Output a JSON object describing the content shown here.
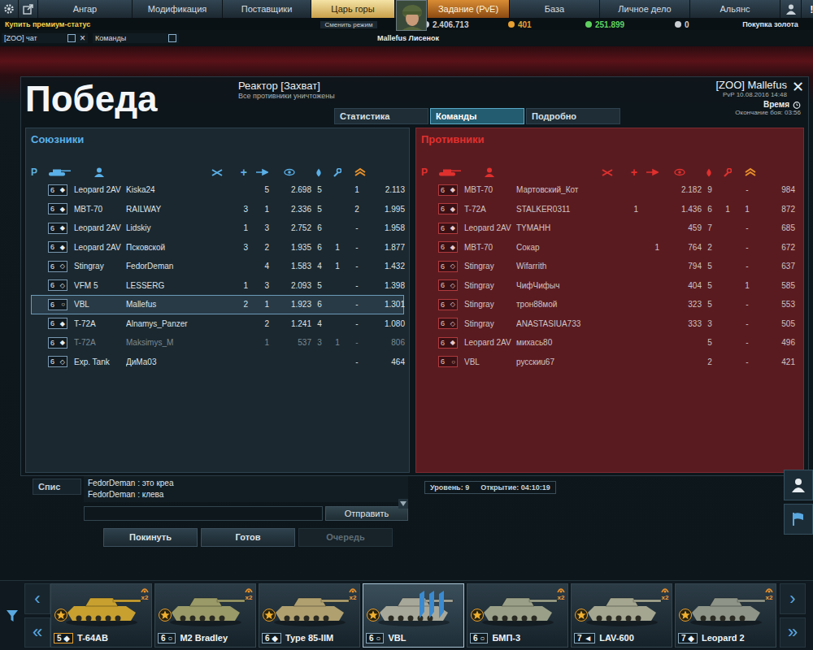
{
  "top_nav": {
    "left_tabs": [
      {
        "label": "Ангар",
        "selected": false,
        "kind": "normal"
      },
      {
        "label": "Модификация",
        "selected": false,
        "kind": "normal"
      },
      {
        "label": "Поставщики",
        "selected": false,
        "kind": "normal"
      },
      {
        "label": "Царь горы",
        "selected": true,
        "kind": "normal"
      }
    ],
    "right_tabs": [
      {
        "label": "Задание (PvE)",
        "selected": false,
        "kind": "mission"
      },
      {
        "label": "База",
        "selected": false,
        "kind": "normal"
      },
      {
        "label": "Личное дело",
        "selected": false,
        "kind": "normal"
      },
      {
        "label": "Альянс",
        "selected": false,
        "kind": "normal"
      }
    ],
    "alert": "!"
  },
  "sub_bar": {
    "premium": "Купить премиум-статус",
    "mode_switch": "Сменить режим",
    "currencies": [
      {
        "value": "2.406.713",
        "color": "#c9ced2"
      },
      {
        "value": "401",
        "color": "#e8a030"
      },
      {
        "value": "251.899",
        "color": "#5fd060"
      },
      {
        "value": "0",
        "color": "#c9ced2"
      }
    ],
    "buy_gold": "Покупка золота"
  },
  "chat_bar": {
    "filters": [
      {
        "label": "[ZOO] чат",
        "checked": false,
        "close": "×"
      },
      {
        "label": "Команды",
        "checked": false,
        "close": ""
      }
    ]
  },
  "player_name": "Mallefus Лисенок",
  "result": {
    "title": "Победа",
    "map": "Реактор [Захват]",
    "outcome": "Все противники уничтожены",
    "tabs": [
      {
        "label": "Статистика",
        "selected": false
      },
      {
        "label": "Команды",
        "selected": true
      },
      {
        "label": "Подробно",
        "selected": false
      }
    ],
    "player": "[ZOO] Mallefus",
    "match_info": "PvP 10.08.2016 14:48",
    "time_label": "Время",
    "battle_end": "Окончание боя: 03:56",
    "close": "✕"
  },
  "teams": [
    {
      "kind": "allies",
      "title": "Союзники",
      "rank_header": "Р",
      "assist_header": "+",
      "rows": [
        {
          "tier": "6",
          "class_icon": "◆",
          "vehicle": "Leopard 2AV",
          "player": "Kiska24",
          "kills": "",
          "assists": "5",
          "damage": "2.698",
          "spotted": "5",
          "blocked": "",
          "repairs": "1",
          "score": "2.113",
          "selected": false,
          "dimmed": false
        },
        {
          "tier": "6",
          "class_icon": "◆",
          "vehicle": "MBT-70",
          "player": "RAILWAY",
          "kills": "3",
          "assists": "1",
          "damage": "2.336",
          "spotted": "5",
          "blocked": "",
          "repairs": "2",
          "score": "1.995",
          "selected": false,
          "dimmed": false
        },
        {
          "tier": "6",
          "class_icon": "◆",
          "vehicle": "Leopard 2AV",
          "player": "Lidskiy",
          "kills": "1",
          "assists": "3",
          "damage": "2.752",
          "spotted": "6",
          "blocked": "",
          "repairs": "-",
          "score": "1.958",
          "selected": false,
          "dimmed": false
        },
        {
          "tier": "6",
          "class_icon": "◆",
          "vehicle": "Leopard 2AV",
          "player": "Псковской",
          "kills": "3",
          "assists": "2",
          "damage": "1.935",
          "spotted": "6",
          "blocked": "1",
          "repairs": "-",
          "score": "1.877",
          "selected": false,
          "dimmed": false
        },
        {
          "tier": "6",
          "class_icon": "◇",
          "vehicle": "Stingray",
          "player": "FedorDeman",
          "kills": "",
          "assists": "4",
          "damage": "1.583",
          "spotted": "4",
          "blocked": "1",
          "repairs": "-",
          "score": "1.432",
          "selected": false,
          "dimmed": false
        },
        {
          "tier": "6",
          "class_icon": "◇",
          "vehicle": "VFM 5",
          "player": "LESSERG",
          "kills": "1",
          "assists": "3",
          "damage": "2.093",
          "spotted": "5",
          "blocked": "",
          "repairs": "-",
          "score": "1.398",
          "selected": false,
          "dimmed": false
        },
        {
          "tier": "6",
          "class_icon": "○",
          "vehicle": "VBL",
          "player": "Mallefus",
          "kills": "2",
          "assists": "1",
          "damage": "1.923",
          "spotted": "6",
          "blocked": "",
          "repairs": "-",
          "score": "1.301",
          "selected": true,
          "dimmed": false
        },
        {
          "tier": "6",
          "class_icon": "◆",
          "vehicle": "T-72A",
          "player": "Alnamys_Panzer",
          "kills": "",
          "assists": "2",
          "damage": "1.241",
          "spotted": "4",
          "blocked": "",
          "repairs": "-",
          "score": "1.080",
          "selected": false,
          "dimmed": false
        },
        {
          "tier": "6",
          "class_icon": "◆",
          "vehicle": "T-72A",
          "player": "Maksimys_M",
          "kills": "",
          "assists": "1",
          "damage": "537",
          "spotted": "3",
          "blocked": "1",
          "repairs": "-",
          "score": "806",
          "selected": false,
          "dimmed": true
        },
        {
          "tier": "6",
          "class_icon": "◇",
          "vehicle": "Exp. Tank",
          "player": "ДиМа03",
          "kills": "",
          "assists": "",
          "damage": "",
          "spotted": "",
          "blocked": "",
          "repairs": "-",
          "score": "464",
          "selected": false,
          "dimmed": false
        }
      ]
    },
    {
      "kind": "enemies",
      "title": "Противники",
      "rank_header": "Р",
      "assist_header": "+",
      "rows": [
        {
          "tier": "6",
          "class_icon": "◆",
          "vehicle": "MBT-70",
          "player": "Мартовский_Кот",
          "kills": "",
          "assists": "",
          "damage": "2.182",
          "spotted": "9",
          "blocked": "",
          "repairs": "-",
          "score": "984",
          "selected": false,
          "dimmed": false
        },
        {
          "tier": "6",
          "class_icon": "◆",
          "vehicle": "T-72A",
          "player": "STALKER0311",
          "kills": "1",
          "assists": "",
          "damage": "1.436",
          "spotted": "6",
          "blocked": "1",
          "repairs": "1",
          "score": "872",
          "selected": false,
          "dimmed": false
        },
        {
          "tier": "6",
          "class_icon": "◆",
          "vehicle": "Leopard 2AV",
          "player": "TYMAHH",
          "kills": "",
          "assists": "",
          "damage": "459",
          "spotted": "7",
          "blocked": "",
          "repairs": "-",
          "score": "685",
          "selected": false,
          "dimmed": false
        },
        {
          "tier": "6",
          "class_icon": "◆",
          "vehicle": "MBT-70",
          "player": "Сокар",
          "kills": "",
          "assists": "1",
          "damage": "764",
          "spotted": "2",
          "blocked": "",
          "repairs": "-",
          "score": "672",
          "selected": false,
          "dimmed": false
        },
        {
          "tier": "6",
          "class_icon": "◇",
          "vehicle": "Stingray",
          "player": "Wifarrith",
          "kills": "",
          "assists": "",
          "damage": "794",
          "spotted": "5",
          "blocked": "",
          "repairs": "-",
          "score": "637",
          "selected": false,
          "dimmed": false
        },
        {
          "tier": "6",
          "class_icon": "◇",
          "vehicle": "Stingray",
          "player": "ЧифЧифыч",
          "kills": "",
          "assists": "",
          "damage": "404",
          "spotted": "5",
          "blocked": "",
          "repairs": "1",
          "score": "585",
          "selected": false,
          "dimmed": false
        },
        {
          "tier": "6",
          "class_icon": "◇",
          "vehicle": "Stingray",
          "player": "трон88мой",
          "kills": "",
          "assists": "",
          "damage": "323",
          "spotted": "5",
          "blocked": "",
          "repairs": "-",
          "score": "553",
          "selected": false,
          "dimmed": false
        },
        {
          "tier": "6",
          "class_icon": "◇",
          "vehicle": "Stingray",
          "player": "ANASTASIUA733",
          "kills": "",
          "assists": "",
          "damage": "333",
          "spotted": "3",
          "blocked": "",
          "repairs": "-",
          "score": "505",
          "selected": false,
          "dimmed": false
        },
        {
          "tier": "6",
          "class_icon": "◆",
          "vehicle": "Leopard 2AV",
          "player": "михась80",
          "kills": "",
          "assists": "",
          "damage": "",
          "spotted": "5",
          "blocked": "",
          "repairs": "-",
          "score": "496",
          "selected": false,
          "dimmed": false
        },
        {
          "tier": "6",
          "class_icon": "○",
          "vehicle": "VBL",
          "player": "русскиu67",
          "kills": "",
          "assists": "",
          "damage": "",
          "spotted": "2",
          "blocked": "",
          "repairs": "-",
          "score": "421",
          "selected": false,
          "dimmed": false
        }
      ]
    }
  ],
  "lobby": {
    "side_button": "Спис",
    "chat": [
      "FedorDeman : это креа",
      "FedorDeman : клева"
    ],
    "chat_input": "",
    "send": "Отправить",
    "buttons": [
      {
        "label": "Покинуть",
        "disabled": false
      },
      {
        "label": "Готов",
        "disabled": false
      },
      {
        "label": "Очередь",
        "disabled": true
      }
    ],
    "room_info": {
      "level": "Уровень: 9",
      "opening": "Открытие: 04:10:19"
    }
  },
  "carousel": {
    "prev": "‹",
    "first": "«",
    "next": "›",
    "last": "»",
    "cards": [
      {
        "tier": "5",
        "class_icon": "◆",
        "name": "T-64AB",
        "bonus": "x2",
        "selected": false,
        "color": "#c8a030"
      },
      {
        "tier": "6",
        "class_icon": "○",
        "name": "M2 Bradley",
        "bonus": "x2",
        "selected": false,
        "color": "#9a9a68"
      },
      {
        "tier": "6",
        "class_icon": "◆",
        "name": "Type 85-IIM",
        "bonus": "x2",
        "selected": false,
        "color": "#b0a070"
      },
      {
        "tier": "6",
        "class_icon": "○",
        "name": "VBL",
        "bonus": "",
        "selected": true,
        "color": "#a8a89a"
      },
      {
        "tier": "6",
        "class_icon": "○",
        "name": "БМП-3",
        "bonus": "x2",
        "selected": false,
        "color": "#9aa088"
      },
      {
        "tier": "7",
        "class_icon": "◄",
        "name": "LAV-600",
        "bonus": "x2",
        "selected": false,
        "color": "#a4a690"
      },
      {
        "tier": "7",
        "class_icon": "◆",
        "name": "Leopard 2",
        "bonus": "x2",
        "selected": false,
        "color": "#8e9488"
      }
    ]
  }
}
